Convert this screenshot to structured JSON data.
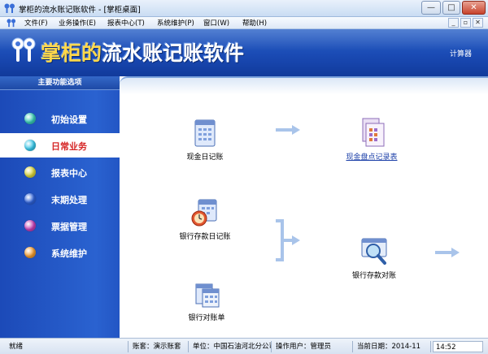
{
  "window": {
    "title": "掌柜的流水账记账软件 - [掌柜桌面]",
    "controls": [
      "—",
      "□",
      "✕"
    ]
  },
  "menu": {
    "items": [
      "文件(F)",
      "业务操作(E)",
      "报表中心(T)",
      "系统维护(P)",
      "窗口(W)",
      "帮助(H)"
    ],
    "mdi_controls": [
      "_",
      "▫",
      "✕"
    ]
  },
  "banner": {
    "title_highlight": "掌柜的",
    "title_rest": "流水账记账软件",
    "calc_link": "计算器"
  },
  "sidebar": {
    "header": "主要功能选项",
    "active_index": 1,
    "items": [
      {
        "label": "初始设置",
        "color": "#38c9b4"
      },
      {
        "label": "日常业务",
        "color": "#36c6e8"
      },
      {
        "label": "报表中心",
        "color": "#d8d33a"
      },
      {
        "label": "末期处理",
        "color": "#2f62d8"
      },
      {
        "label": "票据管理",
        "color": "#c53fb4"
      },
      {
        "label": "系统维护",
        "color": "#f09a2e"
      }
    ]
  },
  "main": {
    "features": [
      {
        "label": "现金日记账",
        "icon": "cash-journal-icon"
      },
      {
        "label": "现金盘点记录表",
        "icon": "cash-count-icon",
        "link": true
      },
      {
        "label": "银行存款日记账",
        "icon": "bank-journal-icon"
      },
      {
        "label": "银行存款对账",
        "icon": "bank-reconcile-icon"
      },
      {
        "label": "银行对账单",
        "icon": "bank-statement-icon"
      }
    ]
  },
  "statusbar": {
    "ready": "就绪",
    "account": "账套：演示账套",
    "unit": "单位：中国石油河北分公司",
    "operator": "操作用户：管理员",
    "date": "当前日期：2014-11",
    "time": "14:52"
  }
}
